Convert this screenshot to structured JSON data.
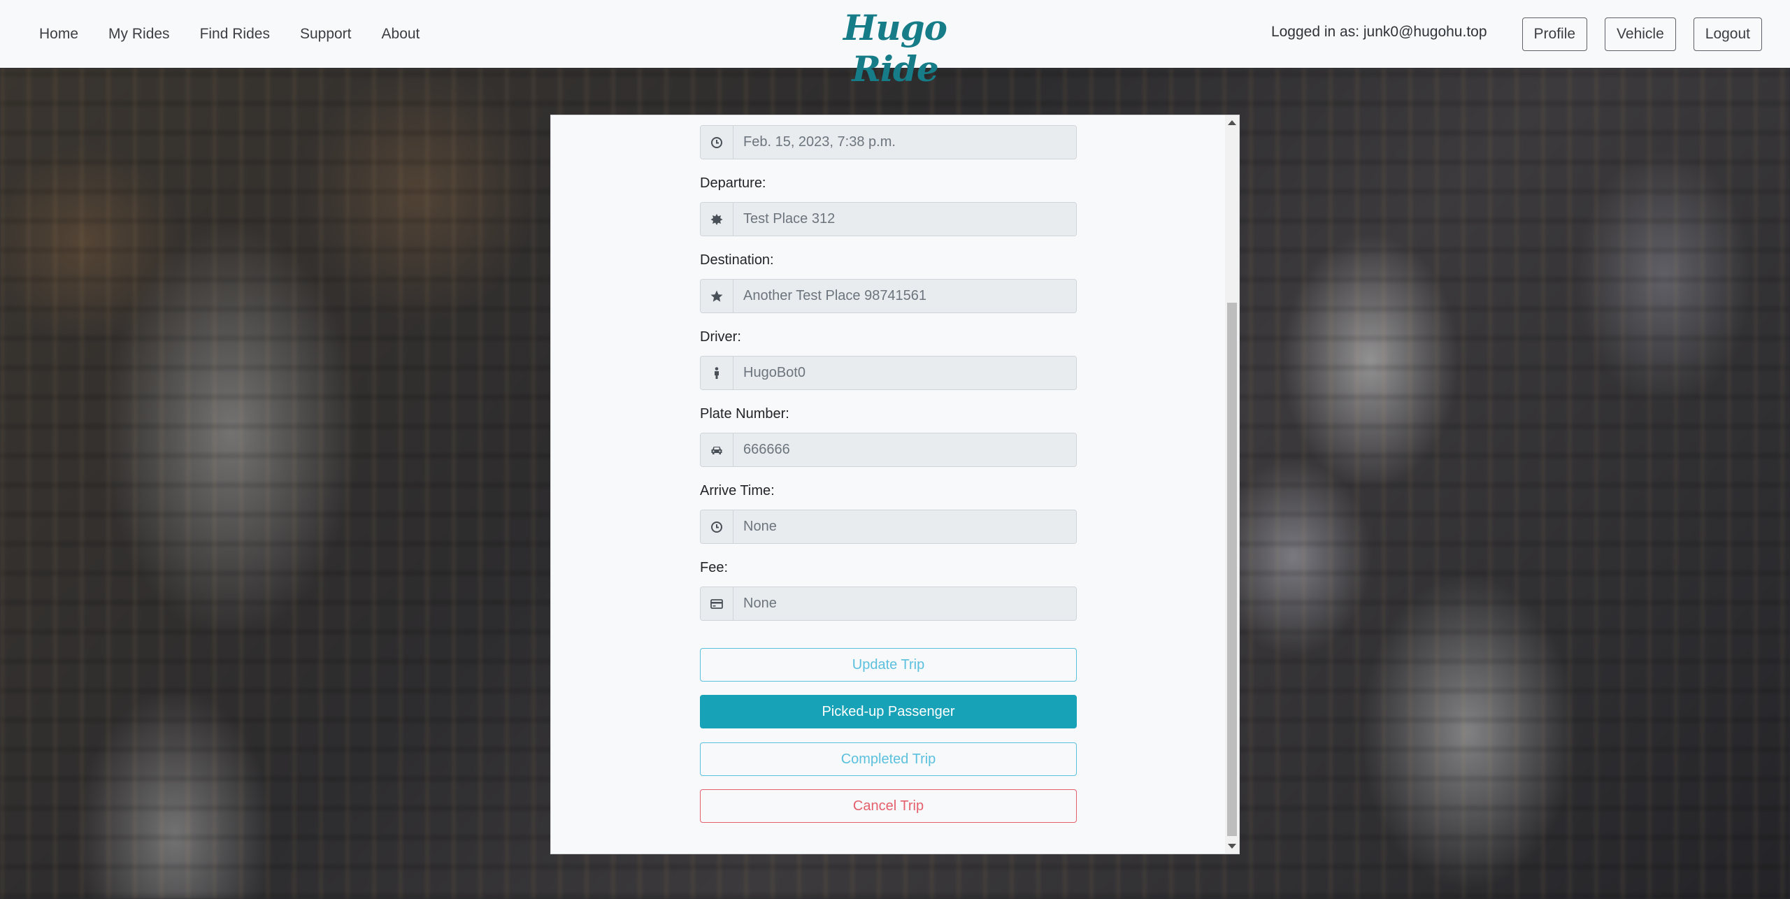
{
  "nav": {
    "links": [
      "Home",
      "My Rides",
      "Find Rides",
      "Support",
      "About"
    ],
    "brand": "Hugo Ride",
    "logged_in_text": "Logged in as: junk0@hugohu.top",
    "buttons": [
      "Profile",
      "Vehicle",
      "Logout"
    ]
  },
  "form": {
    "fields": [
      {
        "label": "",
        "icon": "clock-icon",
        "value": "Feb. 15, 2023, 7:38 p.m."
      },
      {
        "label": "Departure:",
        "icon": "burst-icon",
        "value": "Test Place 312"
      },
      {
        "label": "Destination:",
        "icon": "star-icon",
        "value": "Another Test Place 98741561"
      },
      {
        "label": "Driver:",
        "icon": "person-icon",
        "value": "HugoBot0"
      },
      {
        "label": "Plate Number:",
        "icon": "car-icon",
        "value": "666666"
      },
      {
        "label": "Arrive Time:",
        "icon": "clock-icon",
        "value": "None"
      },
      {
        "label": "Fee:",
        "icon": "credit-card-icon",
        "value": "None"
      }
    ],
    "buttons": {
      "update": "Update Trip",
      "picked_up": "Picked-up Passenger",
      "completed": "Completed Trip",
      "cancel": "Cancel Trip"
    }
  },
  "colors": {
    "brand": "#157c88",
    "info": "#17a2b8",
    "info_outline": "#5bc0de",
    "danger": "#e4606d"
  }
}
